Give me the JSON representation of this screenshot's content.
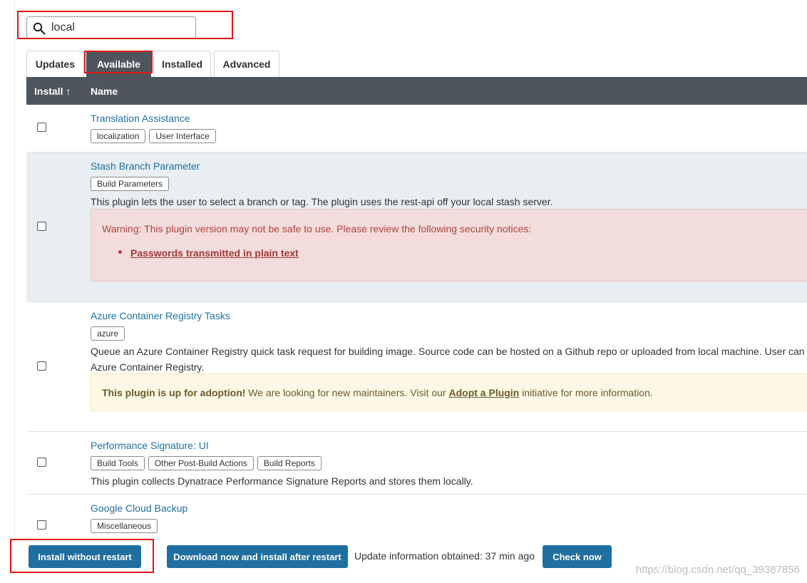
{
  "search": {
    "value": "local"
  },
  "tabs": [
    {
      "label": "Updates"
    },
    {
      "label": "Available"
    },
    {
      "label": "Installed"
    },
    {
      "label": "Advanced"
    }
  ],
  "table": {
    "col_install": "Install ↑",
    "col_name": "Name"
  },
  "plugins": [
    {
      "name": "Translation Assistance",
      "tags": [
        "localization",
        "User Interface"
      ]
    },
    {
      "name": "Stash Branch Parameter",
      "tags": [
        "Build Parameters"
      ],
      "description": "This plugin lets the user to select a branch or tag. The plugin uses the rest-api off your local stash server.",
      "warning": {
        "text": "Warning: This plugin version may not be safe to use. Please review the following security notices:",
        "link": "Passwords transmitted in plain text"
      }
    },
    {
      "name": "Azure Container Registry Tasks",
      "tags": [
        "azure"
      ],
      "description_line1": "Queue an Azure Container Registry quick task request for building image. Source code can be hosted on a Github repo or uploaded from local machine. User can c",
      "description_line2": "Azure Container Registry.",
      "adoption": {
        "bold": "This plugin is up for adoption!",
        "text1": " We are looking for new maintainers. Visit our ",
        "link": "Adopt a Plugin",
        "text2": " initiative for more information."
      }
    },
    {
      "name": "Performance Signature: UI",
      "tags": [
        "Build Tools",
        "Other Post-Build Actions",
        "Build Reports"
      ],
      "description": "This plugin collects Dynatrace Performance Signature Reports and stores them locally."
    },
    {
      "name": "Google Cloud Backup",
      "tags": [
        "Miscellaneous"
      ]
    }
  ],
  "footer": {
    "install_without_restart": "Install without restart",
    "download_install_after_restart": "Download now and install after restart",
    "update_info": "Update information obtained: 37 min ago",
    "check_now": "Check now",
    "watermark": "https://blog.csdn.net/qq_39387856"
  },
  "colors": {
    "header_bg": "#4f555c",
    "link": "#1f6fa0",
    "button": "#1f6fa0",
    "warning_bg": "#f3dcdc",
    "adoption_bg": "#fdf8e6",
    "highlight_red": "#e01616"
  }
}
